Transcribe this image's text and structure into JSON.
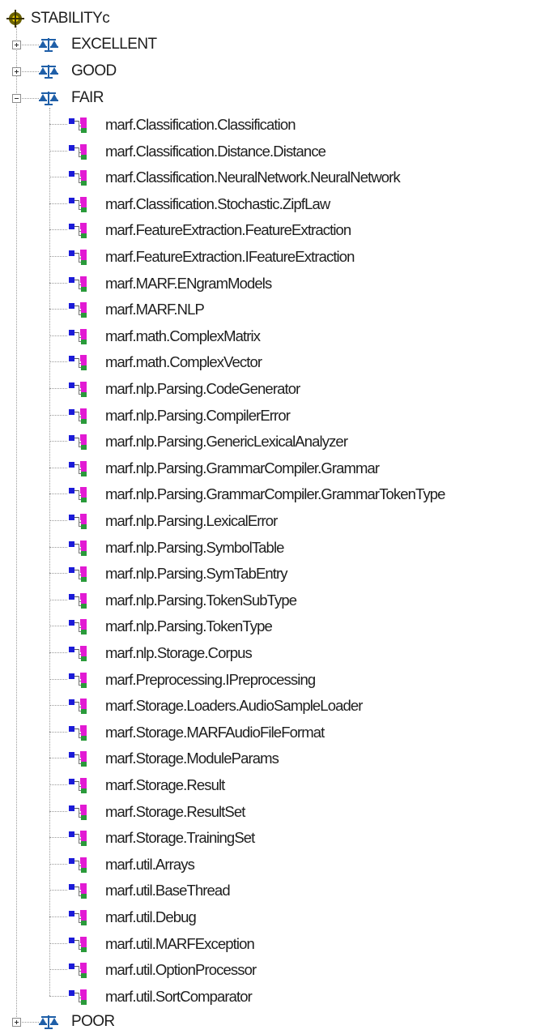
{
  "tree": {
    "root": {
      "label": "STABILITYc",
      "icon": "crosshair-target-icon"
    },
    "categories": [
      {
        "label": "EXCELLENT",
        "icon": "scales-icon",
        "expanded": false
      },
      {
        "label": "GOOD",
        "icon": "scales-icon",
        "expanded": false
      },
      {
        "label": "FAIR",
        "icon": "scales-icon",
        "expanded": true,
        "children": [
          "marf.Classification.Classification",
          "marf.Classification.Distance.Distance",
          "marf.Classification.NeuralNetwork.NeuralNetwork",
          "marf.Classification.Stochastic.ZipfLaw",
          "marf.FeatureExtraction.FeatureExtraction",
          "marf.FeatureExtraction.IFeatureExtraction",
          "marf.MARF.ENgramModels",
          "marf.MARF.NLP",
          "marf.math.ComplexMatrix",
          "marf.math.ComplexVector",
          "marf.nlp.Parsing.CodeGenerator",
          "marf.nlp.Parsing.CompilerError",
          "marf.nlp.Parsing.GenericLexicalAnalyzer",
          "marf.nlp.Parsing.GrammarCompiler.Grammar",
          "marf.nlp.Parsing.GrammarCompiler.GrammarTokenType",
          "marf.nlp.Parsing.LexicalError",
          "marf.nlp.Parsing.SymbolTable",
          "marf.nlp.Parsing.SymTabEntry",
          "marf.nlp.Parsing.TokenSubType",
          "marf.nlp.Parsing.TokenType",
          "marf.nlp.Storage.Corpus",
          "marf.Preprocessing.IPreprocessing",
          "marf.Storage.Loaders.AudioSampleLoader",
          "marf.Storage.MARFAudioFileFormat",
          "marf.Storage.ModuleParams",
          "marf.Storage.Result",
          "marf.Storage.ResultSet",
          "marf.Storage.TrainingSet",
          "marf.util.Arrays",
          "marf.util.BaseThread",
          "marf.util.Debug",
          "marf.util.MARFException",
          "marf.util.OptionProcessor",
          "marf.util.SortComparator"
        ],
        "child_icon": "class-hierarchy-icon"
      },
      {
        "label": "POOR",
        "icon": "scales-icon",
        "expanded": false
      }
    ]
  },
  "colors": {
    "scales": "#1f5fa8",
    "node_blue": "#1b1bd8",
    "node_magenta": "#e21ad3",
    "connector": "#9a9a9a",
    "root_icon": "#6b6200"
  }
}
